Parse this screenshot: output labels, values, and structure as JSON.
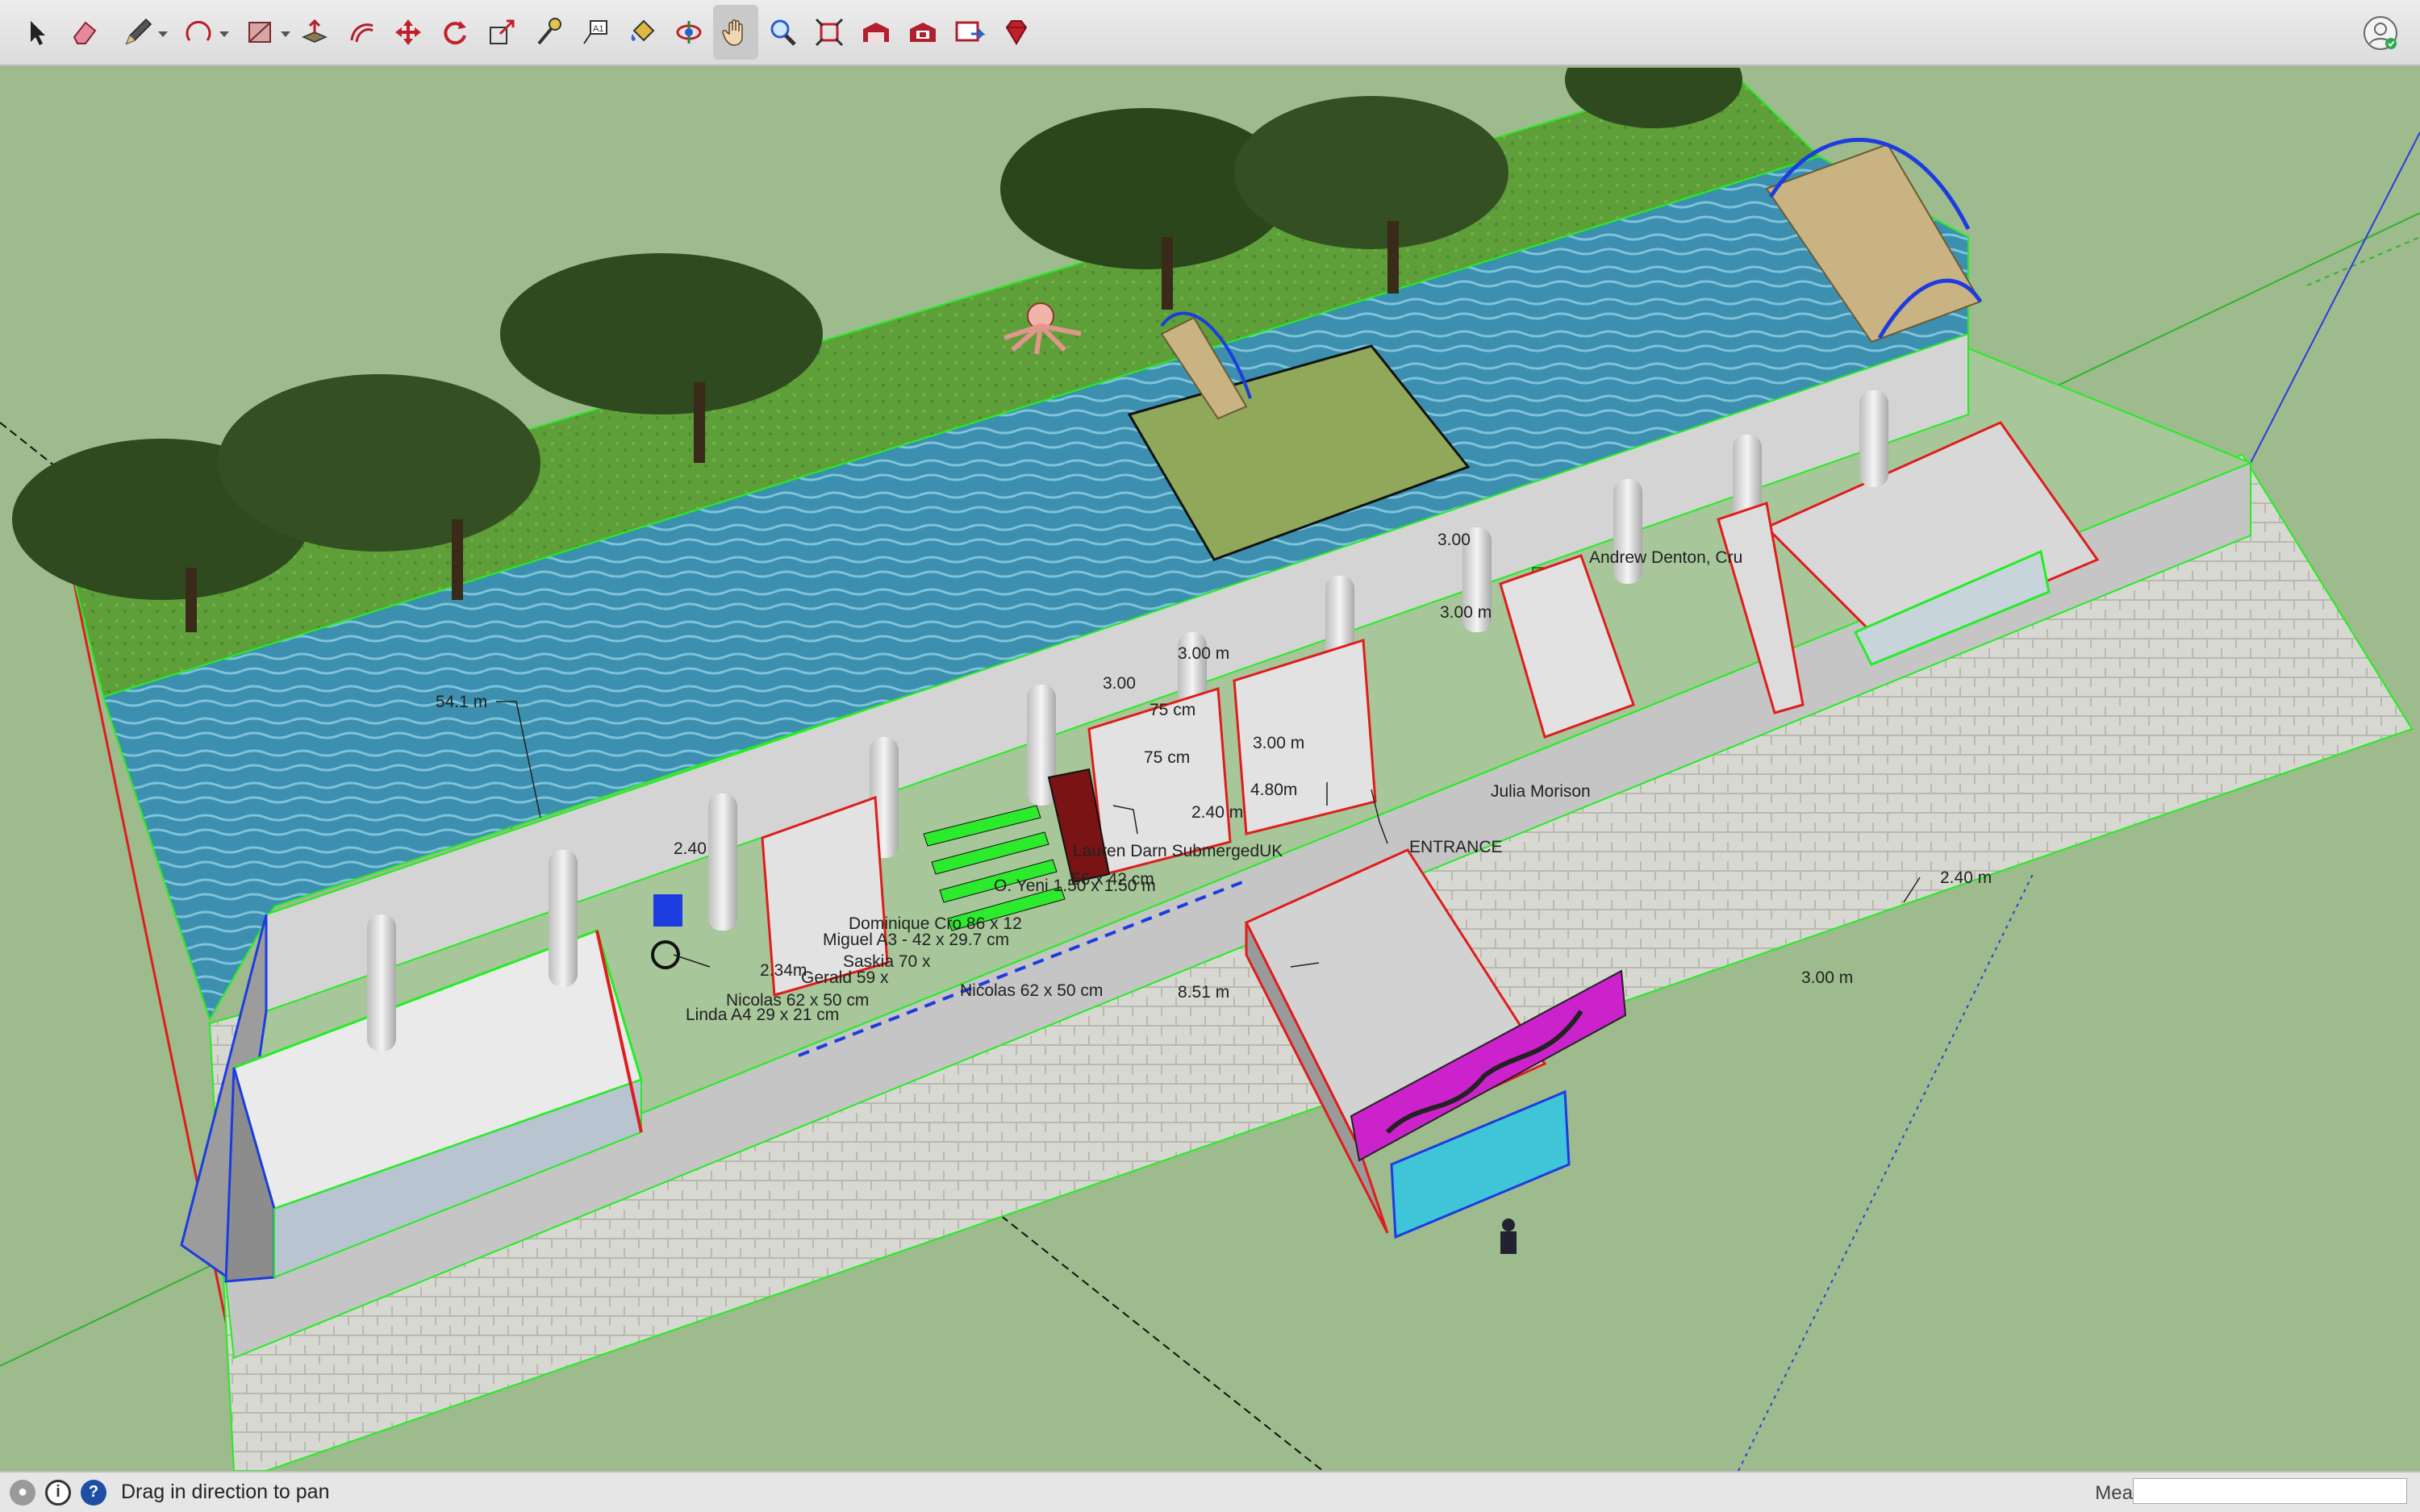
{
  "toolbar": {
    "tools": [
      {
        "id": "select",
        "icon": "select-arrow-icon"
      },
      {
        "id": "eraser",
        "icon": "eraser-icon"
      },
      {
        "id": "line",
        "icon": "pencil-icon",
        "dropdown": true
      },
      {
        "id": "arc",
        "icon": "arc-icon",
        "dropdown": true
      },
      {
        "id": "shape",
        "icon": "rectangle-icon",
        "dropdown": true
      },
      {
        "id": "push-pull",
        "icon": "push-pull-icon"
      },
      {
        "id": "offset",
        "icon": "offset-icon"
      },
      {
        "id": "move",
        "icon": "move-icon"
      },
      {
        "id": "rotate",
        "icon": "rotate-icon"
      },
      {
        "id": "scale",
        "icon": "scale-icon"
      },
      {
        "id": "tape-measure",
        "icon": "tape-measure-icon"
      },
      {
        "id": "text",
        "icon": "text-icon"
      },
      {
        "id": "paint-bucket",
        "icon": "paint-bucket-icon"
      },
      {
        "id": "orbit",
        "icon": "orbit-icon"
      },
      {
        "id": "pan",
        "icon": "pan-hand-icon",
        "active": true
      },
      {
        "id": "zoom",
        "icon": "zoom-icon"
      },
      {
        "id": "zoom-extents",
        "icon": "zoom-extents-icon"
      },
      {
        "id": "warehouse",
        "icon": "3d-warehouse-icon"
      },
      {
        "id": "extension-warehouse",
        "icon": "extension-warehouse-icon"
      },
      {
        "id": "send-to-layout",
        "icon": "send-to-layout-icon"
      },
      {
        "id": "ruby",
        "icon": "ruby-gem-icon"
      }
    ],
    "profile_icon": "user-profile-icon"
  },
  "scene": {
    "labels": [
      {
        "text": "54.1 m"
      },
      {
        "text": "2.40"
      },
      {
        "text": "2.34m"
      },
      {
        "text": "Nicolas 62 x 50 cm"
      },
      {
        "text": "Linda A4 29 x 21 cm"
      },
      {
        "text": "Gerald 59 x"
      },
      {
        "text": "Saskia 70 x"
      },
      {
        "text": "Miguel A3 - 42 x 29.7 cm"
      },
      {
        "text": "Dominique Cro 86 x 12"
      },
      {
        "text": "Nicolas 62 x 50 cm"
      },
      {
        "text": "O. Yeni 1.50 x 1.50 m"
      },
      {
        "text": "56 x 42 cm"
      },
      {
        "text": "Lauren Darn SubmergedUK"
      },
      {
        "text": "2.40 m"
      },
      {
        "text": "75 cm"
      },
      {
        "text": "75 cm"
      },
      {
        "text": "3.00"
      },
      {
        "text": "3.00 m"
      },
      {
        "text": "3.00 m"
      },
      {
        "text": "4.80m"
      },
      {
        "text": "ENTRANCE"
      },
      {
        "text": "8.51 m"
      },
      {
        "text": "Julia Morison"
      },
      {
        "text": "3.00"
      },
      {
        "text": "3.00 m"
      },
      {
        "text": "Andrew Denton, Cru"
      },
      {
        "text": "2.40 m"
      },
      {
        "text": "3.00 m"
      }
    ]
  },
  "statusbar": {
    "icons": [
      "geo-location-icon",
      "credits-icon",
      "help-icon"
    ],
    "message": "Drag in direction to pan",
    "measurements_label": "Measurements",
    "measurements_value": ""
  },
  "colors": {
    "background": "#9dbb8c",
    "water": "#3d8fb0",
    "lawn": "#5f9e3c",
    "paving": "#d9d9d4",
    "wall": "#cfcfcf",
    "edge_green": "#22ee22",
    "edge_red": "#e01c1c",
    "edge_blue": "#1c3ce0",
    "sign_magenta": "#cc22cc"
  }
}
